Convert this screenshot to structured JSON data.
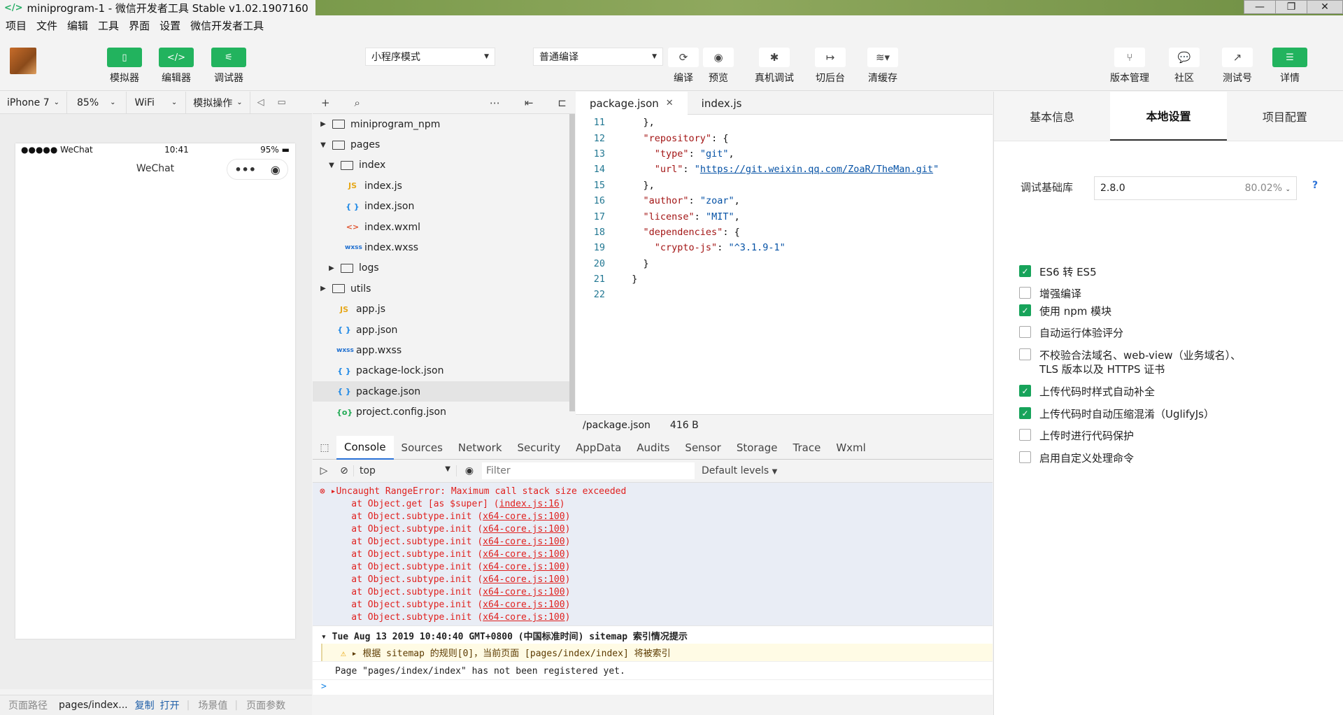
{
  "window": {
    "title": "miniprogram-1 - 微信开发者工具 Stable v1.02.1907160",
    "logo": "</>"
  },
  "menu": [
    "项目",
    "文件",
    "编辑",
    "工具",
    "界面",
    "设置",
    "微信开发者工具"
  ],
  "toolbar": {
    "simulator": "模拟器",
    "editor": "编辑器",
    "debugger": "调试器",
    "mode": "小程序模式",
    "compile_mode": "普通编译",
    "compile": "编译",
    "preview": "预览",
    "remote_debug": "真机调试",
    "background": "切后台",
    "clear_cache": "清缓存",
    "version": "版本管理",
    "community": "社区",
    "test": "测试号",
    "details": "详情"
  },
  "simulator_bar": {
    "device": "iPhone 7",
    "zoom": "85%",
    "network": "WiFi",
    "operation": "模拟操作"
  },
  "phone": {
    "carrier": "●●●●● WeChat",
    "time": "10:41",
    "battery": "95%",
    "nav_title": "WeChat"
  },
  "bottom": {
    "path_label": "页面路径",
    "path_value": "pages/index...",
    "copy": "复制",
    "open": "打开",
    "scene": "场景值",
    "params": "页面参数"
  },
  "explorer": [
    {
      "type": "folder",
      "name": "miniprogram_npm",
      "level": 0,
      "expanded": false
    },
    {
      "type": "folder",
      "name": "pages",
      "level": 0,
      "expanded": true
    },
    {
      "type": "folder",
      "name": "index",
      "level": 1,
      "expanded": true
    },
    {
      "type": "js",
      "icon": "JS",
      "name": "index.js",
      "level": 2
    },
    {
      "type": "json",
      "icon": "{ }",
      "name": "index.json",
      "level": 2
    },
    {
      "type": "wxml",
      "icon": "<>",
      "name": "index.wxml",
      "level": 2
    },
    {
      "type": "wxss",
      "icon": "wxss",
      "name": "index.wxss",
      "level": 2
    },
    {
      "type": "folder",
      "name": "logs",
      "level": 1,
      "expanded": false
    },
    {
      "type": "folder",
      "name": "utils",
      "level": 0,
      "expanded": false
    },
    {
      "type": "js",
      "icon": "JS",
      "name": "app.js",
      "level": 1
    },
    {
      "type": "json",
      "icon": "{ }",
      "name": "app.json",
      "level": 1
    },
    {
      "type": "wxss",
      "icon": "wxss",
      "name": "app.wxss",
      "level": 1
    },
    {
      "type": "json",
      "icon": "{ }",
      "name": "package-lock.json",
      "level": 1
    },
    {
      "type": "json",
      "icon": "{ }",
      "name": "package.json",
      "level": 1,
      "active": true
    },
    {
      "type": "cfg",
      "icon": "{o}",
      "name": "project.config.json",
      "level": 1
    }
  ],
  "editor_tabs": [
    "package.json",
    "index.js"
  ],
  "code": [
    {
      "n": "11",
      "t": [
        [
          "p",
          "    },"
        ]
      ]
    },
    {
      "n": "12",
      "t": [
        [
          "p",
          "    "
        ],
        [
          "k",
          "\"repository\""
        ],
        [
          "p",
          ": {"
        ]
      ]
    },
    {
      "n": "13",
      "t": [
        [
          "p",
          "      "
        ],
        [
          "k",
          "\"type\""
        ],
        [
          "p",
          ": "
        ],
        [
          "s",
          "\"git\""
        ],
        [
          "p",
          ","
        ]
      ]
    },
    {
      "n": "14",
      "t": [
        [
          "p",
          "      "
        ],
        [
          "k",
          "\"url\""
        ],
        [
          "p",
          ": "
        ],
        [
          "s",
          "\""
        ],
        [
          "u",
          "https://git.weixin.qq.com/ZoaR/TheMan.git"
        ],
        [
          "s",
          "\""
        ]
      ]
    },
    {
      "n": "15",
      "t": [
        [
          "p",
          "    },"
        ]
      ]
    },
    {
      "n": "16",
      "t": [
        [
          "p",
          "    "
        ],
        [
          "k",
          "\"author\""
        ],
        [
          "p",
          ": "
        ],
        [
          "s",
          "\"zoar\""
        ],
        [
          "p",
          ","
        ]
      ]
    },
    {
      "n": "17",
      "t": [
        [
          "p",
          "    "
        ],
        [
          "k",
          "\"license\""
        ],
        [
          "p",
          ": "
        ],
        [
          "s",
          "\"MIT\""
        ],
        [
          "p",
          ","
        ]
      ]
    },
    {
      "n": "18",
      "t": [
        [
          "p",
          "    "
        ],
        [
          "k",
          "\"dependencies\""
        ],
        [
          "p",
          ": {"
        ]
      ]
    },
    {
      "n": "19",
      "t": [
        [
          "p",
          "      "
        ],
        [
          "k",
          "\"crypto-js\""
        ],
        [
          "p",
          ": "
        ],
        [
          "s",
          "\"^3.1.9-1\""
        ]
      ]
    },
    {
      "n": "20",
      "t": [
        [
          "p",
          "    }"
        ]
      ]
    },
    {
      "n": "21",
      "t": [
        [
          "p",
          "  }"
        ]
      ]
    },
    {
      "n": "22",
      "t": [
        [
          "p",
          ""
        ]
      ]
    }
  ],
  "editor_status": {
    "file": "/package.json",
    "size": "416 B"
  },
  "devtools_tabs": [
    "Console",
    "Sources",
    "Network",
    "Security",
    "AppData",
    "Audits",
    "Sensor",
    "Storage",
    "Trace",
    "Wxml"
  ],
  "devtools_filter": {
    "context": "top",
    "placeholder": "Filter",
    "levels": "Default levels"
  },
  "console": {
    "error_head": "Uncaught RangeError: Maximum call stack size exceeded",
    "stack": [
      {
        "t": "    at Object.get [as $super] (",
        "l": "index.js:16",
        "e": ")"
      },
      {
        "t": "    at Object.subtype.init (",
        "l": "x64-core.js:100",
        "e": ")"
      },
      {
        "t": "    at Object.subtype.init (",
        "l": "x64-core.js:100",
        "e": ")"
      },
      {
        "t": "    at Object.subtype.init (",
        "l": "x64-core.js:100",
        "e": ")"
      },
      {
        "t": "    at Object.subtype.init (",
        "l": "x64-core.js:100",
        "e": ")"
      },
      {
        "t": "    at Object.subtype.init (",
        "l": "x64-core.js:100",
        "e": ")"
      },
      {
        "t": "    at Object.subtype.init (",
        "l": "x64-core.js:100",
        "e": ")"
      },
      {
        "t": "    at Object.subtype.init (",
        "l": "x64-core.js:100",
        "e": ")"
      },
      {
        "t": "    at Object.subtype.init (",
        "l": "x64-core.js:100",
        "e": ")"
      },
      {
        "t": "    at Object.subtype.init (",
        "l": "x64-core.js:100",
        "e": ")"
      }
    ],
    "group_head": "Tue Aug 13 2019 10:40:40 GMT+0800 (中国标准时间) sitemap 索引情况提示",
    "warning": "根据 sitemap 的规则[0]，当前页面 [pages/index/index] 将被索引",
    "log": "Page \"pages/index/index\" has not been registered yet.",
    "prompt": ">"
  },
  "right_panel": {
    "tabs": [
      "基本信息",
      "本地设置",
      "项目配置"
    ],
    "lib_label": "调试基础库",
    "lib_version": "2.8.0",
    "lib_percent": "80.02%",
    "help": "?",
    "options": [
      {
        "label": "ES6 转 ES5",
        "checked": true
      },
      {
        "label": "增强编译",
        "checked": false
      },
      {
        "label": "使用 npm 模块",
        "checked": true
      },
      {
        "label": "自动运行体验评分",
        "checked": false
      },
      {
        "label": "不校验合法域名、web-view（业务域名）、TLS 版本以及 HTTPS 证书",
        "checked": false
      },
      {
        "label": "上传代码时样式自动补全",
        "checked": true
      },
      {
        "label": "上传代码时自动压缩混淆（UglifyJs）",
        "checked": true
      },
      {
        "label": "上传时进行代码保护",
        "checked": false
      },
      {
        "label": "启用自定义处理命令",
        "checked": false
      }
    ]
  },
  "colors": {
    "accent": "#22b35e",
    "error": "#e0211f",
    "link": "#1f5fa8"
  }
}
